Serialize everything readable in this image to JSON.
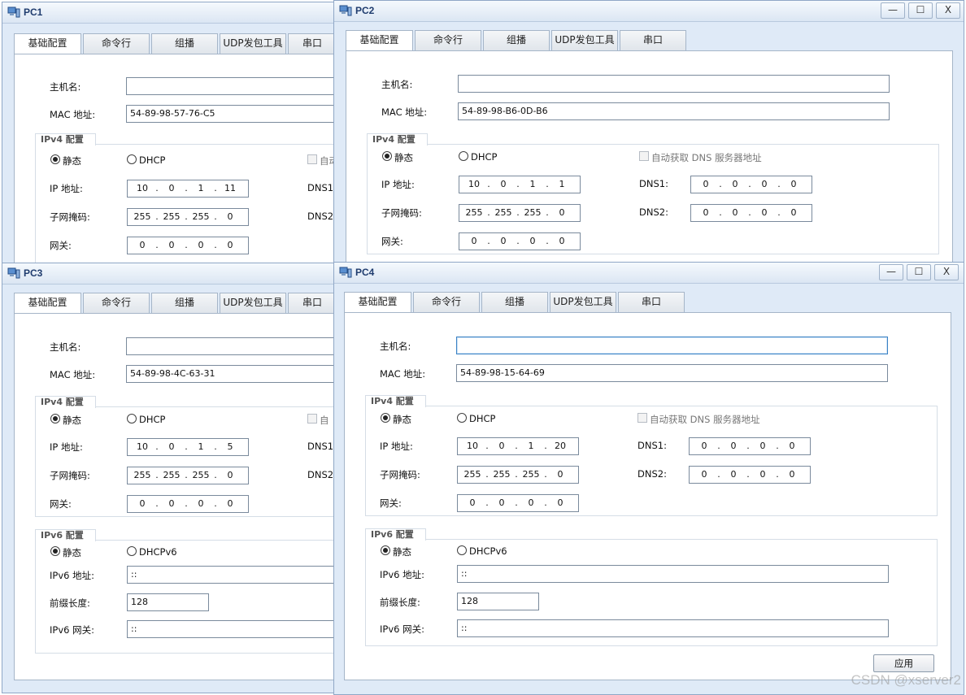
{
  "tabs": [
    "基础配置",
    "命令行",
    "组播",
    "UDP发包工具",
    "串口"
  ],
  "labels": {
    "hostname": "主机名:",
    "mac": "MAC 地址:",
    "ipv4_group": "IPv4 配置",
    "static": "静态",
    "dhcp": "DHCP",
    "auto_dns": "自动获取 DNS 服务器地址",
    "auto_dns_cut": "自动",
    "auto_dns_cut2": "自",
    "ip": "IP 地址:",
    "mask": "子网掩码:",
    "gateway": "网关:",
    "dns1": "DNS1:",
    "dns2": "DNS2:",
    "ipv6_group": "IPv6 配置",
    "dhcpv6": "DHCPv6",
    "ipv6_addr": "IPv6 地址:",
    "prefix": "前缀长度:",
    "ipv6_gw": "IPv6 网关:",
    "apply": "应用"
  },
  "window_buttons": {
    "minimize": "—",
    "maximize": "☐",
    "close": "X"
  },
  "pcs": {
    "pc1": {
      "title": "PC1",
      "hostname": "",
      "mac": "54-89-98-57-76-C5",
      "ip": [
        "10",
        "0",
        "1",
        "11"
      ],
      "mask": [
        "255",
        "255",
        "255",
        "0"
      ],
      "gw": [
        "0",
        "0",
        "0",
        "0"
      ]
    },
    "pc2": {
      "title": "PC2",
      "hostname": "",
      "mac": "54-89-98-B6-0D-B6",
      "ip": [
        "10",
        "0",
        "1",
        "1"
      ],
      "mask": [
        "255",
        "255",
        "255",
        "0"
      ],
      "gw": [
        "0",
        "0",
        "0",
        "0"
      ],
      "dns1": [
        "0",
        "0",
        "0",
        "0"
      ],
      "dns2": [
        "0",
        "0",
        "0",
        "0"
      ]
    },
    "pc3": {
      "title": "PC3",
      "hostname": "",
      "mac": "54-89-98-4C-63-31",
      "ip": [
        "10",
        "0",
        "1",
        "5"
      ],
      "mask": [
        "255",
        "255",
        "255",
        "0"
      ],
      "gw": [
        "0",
        "0",
        "0",
        "0"
      ],
      "ipv6": "::",
      "prefix": "128",
      "ipv6_gw": "::"
    },
    "pc4": {
      "title": "PC4",
      "hostname": "",
      "mac": "54-89-98-15-64-69",
      "ip": [
        "10",
        "0",
        "1",
        "20"
      ],
      "mask": [
        "255",
        "255",
        "255",
        "0"
      ],
      "gw": [
        "0",
        "0",
        "0",
        "0"
      ],
      "dns1": [
        "0",
        "0",
        "0",
        "0"
      ],
      "dns2": [
        "0",
        "0",
        "0",
        "0"
      ],
      "ipv6": "::",
      "prefix": "128",
      "ipv6_gw": "::"
    }
  },
  "watermark": "CSDN @xserver2"
}
